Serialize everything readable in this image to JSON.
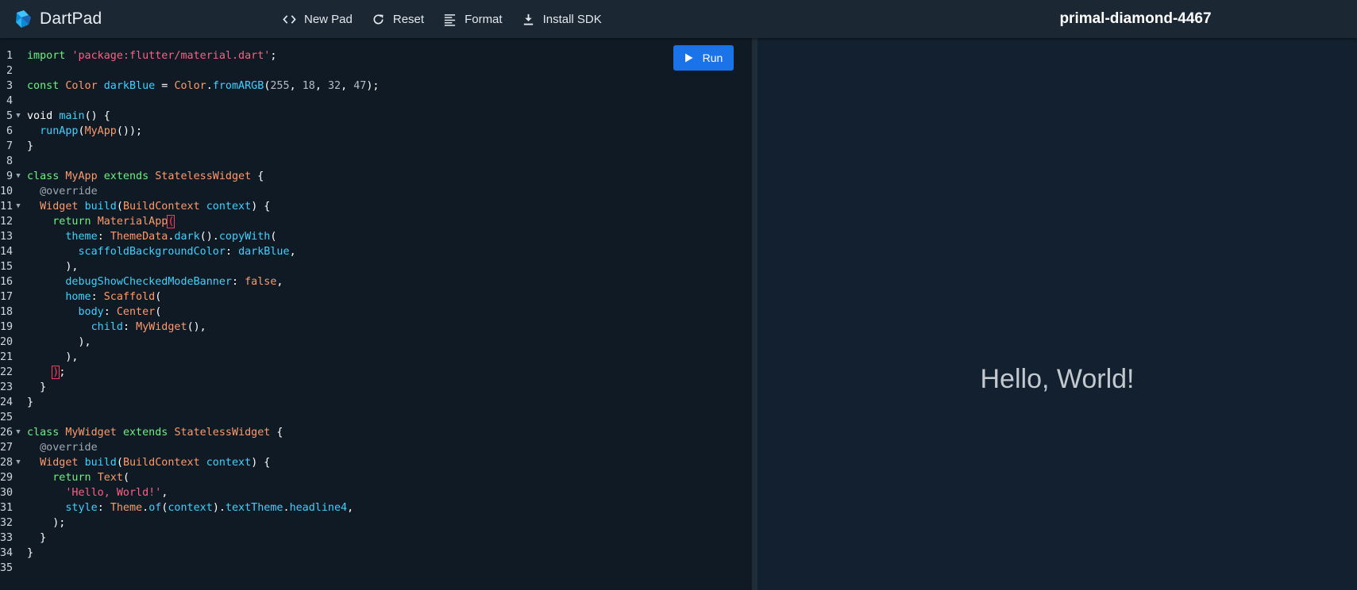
{
  "header": {
    "app_name": "DartPad",
    "toolbar": [
      {
        "label": "New Pad",
        "icon": "code-brackets-icon"
      },
      {
        "label": "Reset",
        "icon": "refresh-icon"
      },
      {
        "label": "Format",
        "icon": "format-lines-icon"
      },
      {
        "label": "Install SDK",
        "icon": "download-icon"
      }
    ],
    "pad_title": "primal-diamond-4467"
  },
  "editor": {
    "run_label": "Run",
    "lines": [
      {
        "n": "1",
        "fold": "",
        "tokens": [
          [
            "kw",
            "import"
          ],
          [
            "pn",
            " "
          ],
          [
            "str",
            "'package:flutter/material.dart'"
          ],
          [
            "pn",
            ";"
          ]
        ]
      },
      {
        "n": "2",
        "fold": "",
        "tokens": []
      },
      {
        "n": "3",
        "fold": "",
        "tokens": [
          [
            "kw",
            "const"
          ],
          [
            "pn",
            " "
          ],
          [
            "ty",
            "Color"
          ],
          [
            "pn",
            " "
          ],
          [
            "id",
            "darkBlue"
          ],
          [
            "pn",
            " = "
          ],
          [
            "ty",
            "Color"
          ],
          [
            "pn",
            "."
          ],
          [
            "id",
            "fromARGB"
          ],
          [
            "pn",
            "("
          ],
          [
            "num",
            "255"
          ],
          [
            "pn",
            ", "
          ],
          [
            "num",
            "18"
          ],
          [
            "pn",
            ", "
          ],
          [
            "num",
            "32"
          ],
          [
            "pn",
            ", "
          ],
          [
            "num",
            "47"
          ],
          [
            "pn",
            ");"
          ]
        ]
      },
      {
        "n": "4",
        "fold": "",
        "tokens": []
      },
      {
        "n": "5",
        "fold": "▼",
        "tokens": [
          [
            "pn",
            "void "
          ],
          [
            "id",
            "main"
          ],
          [
            "pn",
            "() {"
          ]
        ]
      },
      {
        "n": "6",
        "fold": "",
        "tokens": [
          [
            "pn",
            "  "
          ],
          [
            "id",
            "runApp"
          ],
          [
            "pn",
            "("
          ],
          [
            "ty",
            "MyApp"
          ],
          [
            "pn",
            "());"
          ]
        ]
      },
      {
        "n": "7",
        "fold": "",
        "tokens": [
          [
            "pn",
            "}"
          ]
        ]
      },
      {
        "n": "8",
        "fold": "",
        "tokens": []
      },
      {
        "n": "9",
        "fold": "▼",
        "tokens": [
          [
            "kw",
            "class"
          ],
          [
            "pn",
            " "
          ],
          [
            "ty",
            "MyApp"
          ],
          [
            "pn",
            " "
          ],
          [
            "kw",
            "extends"
          ],
          [
            "pn",
            " "
          ],
          [
            "ty",
            "StatelessWidget"
          ],
          [
            "pn",
            " {"
          ]
        ]
      },
      {
        "n": "10",
        "fold": "",
        "tokens": [
          [
            "pn",
            "  "
          ],
          [
            "ann",
            "@override"
          ]
        ]
      },
      {
        "n": "11",
        "fold": "▼",
        "tokens": [
          [
            "pn",
            "  "
          ],
          [
            "ty",
            "Widget"
          ],
          [
            "pn",
            " "
          ],
          [
            "id",
            "build"
          ],
          [
            "pn",
            "("
          ],
          [
            "ty",
            "BuildContext"
          ],
          [
            "pn",
            " "
          ],
          [
            "id",
            "context"
          ],
          [
            "pn",
            ") {"
          ]
        ]
      },
      {
        "n": "12",
        "fold": "",
        "tokens": [
          [
            "pn",
            "    "
          ],
          [
            "kw",
            "return"
          ],
          [
            "pn",
            " "
          ],
          [
            "ty",
            "MaterialApp"
          ],
          [
            "bm",
            "("
          ]
        ]
      },
      {
        "n": "13",
        "fold": "",
        "tokens": [
          [
            "pn",
            "      "
          ],
          [
            "id",
            "theme"
          ],
          [
            "pn",
            ": "
          ],
          [
            "ty",
            "ThemeData"
          ],
          [
            "pn",
            "."
          ],
          [
            "id",
            "dark"
          ],
          [
            "pn",
            "()."
          ],
          [
            "id",
            "copyWith"
          ],
          [
            "pn",
            "("
          ]
        ]
      },
      {
        "n": "14",
        "fold": "",
        "tokens": [
          [
            "pn",
            "        "
          ],
          [
            "id",
            "scaffoldBackgroundColor"
          ],
          [
            "pn",
            ": "
          ],
          [
            "id",
            "darkBlue"
          ],
          [
            "pn",
            ","
          ]
        ]
      },
      {
        "n": "15",
        "fold": "",
        "tokens": [
          [
            "pn",
            "      ),"
          ]
        ]
      },
      {
        "n": "16",
        "fold": "",
        "tokens": [
          [
            "pn",
            "      "
          ],
          [
            "id",
            "debugShowCheckedModeBanner"
          ],
          [
            "pn",
            ": "
          ],
          [
            "ty",
            "false"
          ],
          [
            "pn",
            ","
          ]
        ]
      },
      {
        "n": "17",
        "fold": "",
        "tokens": [
          [
            "pn",
            "      "
          ],
          [
            "id",
            "home"
          ],
          [
            "pn",
            ": "
          ],
          [
            "ty",
            "Scaffold"
          ],
          [
            "pn",
            "("
          ]
        ]
      },
      {
        "n": "18",
        "fold": "",
        "tokens": [
          [
            "pn",
            "        "
          ],
          [
            "id",
            "body"
          ],
          [
            "pn",
            ": "
          ],
          [
            "ty",
            "Center"
          ],
          [
            "pn",
            "("
          ]
        ]
      },
      {
        "n": "19",
        "fold": "",
        "tokens": [
          [
            "pn",
            "          "
          ],
          [
            "id",
            "child"
          ],
          [
            "pn",
            ": "
          ],
          [
            "ty",
            "MyWidget"
          ],
          [
            "pn",
            "(),"
          ]
        ]
      },
      {
        "n": "20",
        "fold": "",
        "tokens": [
          [
            "pn",
            "        ),"
          ]
        ]
      },
      {
        "n": "21",
        "fold": "",
        "tokens": [
          [
            "pn",
            "      ),"
          ]
        ]
      },
      {
        "n": "22",
        "fold": "",
        "tokens": [
          [
            "pn",
            "    "
          ],
          [
            "bm",
            ")"
          ],
          [
            "pn",
            ";"
          ]
        ]
      },
      {
        "n": "23",
        "fold": "",
        "tokens": [
          [
            "pn",
            "  }"
          ]
        ]
      },
      {
        "n": "24",
        "fold": "",
        "tokens": [
          [
            "pn",
            "}"
          ]
        ]
      },
      {
        "n": "25",
        "fold": "",
        "tokens": []
      },
      {
        "n": "26",
        "fold": "▼",
        "tokens": [
          [
            "kw",
            "class"
          ],
          [
            "pn",
            " "
          ],
          [
            "ty",
            "MyWidget"
          ],
          [
            "pn",
            " "
          ],
          [
            "kw",
            "extends"
          ],
          [
            "pn",
            " "
          ],
          [
            "ty",
            "StatelessWidget"
          ],
          [
            "pn",
            " {"
          ]
        ]
      },
      {
        "n": "27",
        "fold": "",
        "tokens": [
          [
            "pn",
            "  "
          ],
          [
            "ann",
            "@override"
          ]
        ]
      },
      {
        "n": "28",
        "fold": "▼",
        "tokens": [
          [
            "pn",
            "  "
          ],
          [
            "ty",
            "Widget"
          ],
          [
            "pn",
            " "
          ],
          [
            "id",
            "build"
          ],
          [
            "pn",
            "("
          ],
          [
            "ty",
            "BuildContext"
          ],
          [
            "pn",
            " "
          ],
          [
            "id",
            "context"
          ],
          [
            "pn",
            ") {"
          ]
        ]
      },
      {
        "n": "29",
        "fold": "",
        "tokens": [
          [
            "pn",
            "    "
          ],
          [
            "kw",
            "return"
          ],
          [
            "pn",
            " "
          ],
          [
            "ty",
            "Text"
          ],
          [
            "pn",
            "("
          ]
        ]
      },
      {
        "n": "30",
        "fold": "",
        "tokens": [
          [
            "pn",
            "      "
          ],
          [
            "str",
            "'Hello, World!'"
          ],
          [
            "pn",
            ","
          ]
        ]
      },
      {
        "n": "31",
        "fold": "",
        "tokens": [
          [
            "pn",
            "      "
          ],
          [
            "id",
            "style"
          ],
          [
            "pn",
            ": "
          ],
          [
            "ty",
            "Theme"
          ],
          [
            "pn",
            "."
          ],
          [
            "id",
            "of"
          ],
          [
            "pn",
            "("
          ],
          [
            "id",
            "context"
          ],
          [
            "pn",
            ")."
          ],
          [
            "id",
            "textTheme"
          ],
          [
            "pn",
            "."
          ],
          [
            "id",
            "headline4"
          ],
          [
            "pn",
            ","
          ]
        ]
      },
      {
        "n": "32",
        "fold": "",
        "tokens": [
          [
            "pn",
            "    );"
          ]
        ]
      },
      {
        "n": "33",
        "fold": "",
        "tokens": [
          [
            "pn",
            "  }"
          ]
        ]
      },
      {
        "n": "34",
        "fold": "",
        "tokens": [
          [
            "pn",
            "}"
          ]
        ]
      },
      {
        "n": "35",
        "fold": "",
        "tokens": []
      }
    ]
  },
  "output": {
    "text": "Hello, World!"
  },
  "colors": {
    "keyword": "#6ef07f",
    "type": "#ff9a6a",
    "identifier": "#3fd1ff",
    "string": "#ff5f82",
    "run_button": "#1a73e8"
  }
}
